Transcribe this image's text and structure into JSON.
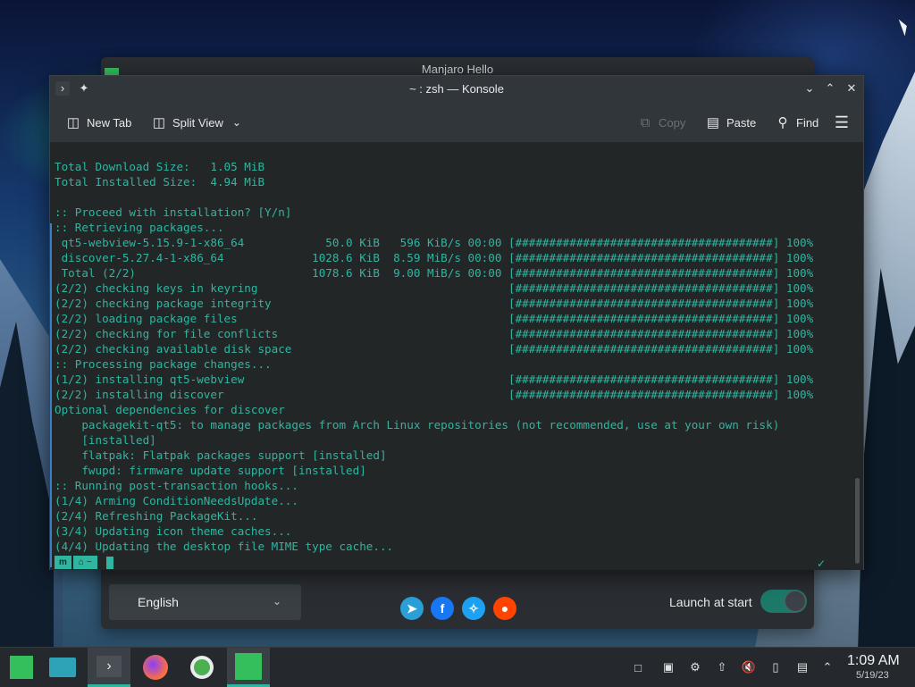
{
  "hello_window": {
    "title": "Manjaro Hello",
    "language": "English",
    "launch_label": "Launch at start",
    "launch_enabled": true
  },
  "konsole": {
    "title": "~ : zsh — Konsole",
    "toolbar": {
      "new_tab": "New Tab",
      "split_view": "Split View",
      "copy": "Copy",
      "paste": "Paste",
      "find": "Find"
    },
    "lines": [
      "Total Download Size:   1.05 MiB",
      "Total Installed Size:  4.94 MiB",
      "",
      ":: Proceed with installation? [Y/n]",
      ":: Retrieving packages...",
      " qt5-webview-5.15.9-1-x86_64            50.0 KiB   596 KiB/s 00:00 [######################################] 100%",
      " discover-5.27.4-1-x86_64             1028.6 KiB  8.59 MiB/s 00:00 [######################################] 100%",
      " Total (2/2)                          1078.6 KiB  9.00 MiB/s 00:00 [######################################] 100%",
      "(2/2) checking keys in keyring                                     [######################################] 100%",
      "(2/2) checking package integrity                                   [######################################] 100%",
      "(2/2) loading package files                                        [######################################] 100%",
      "(2/2) checking for file conflicts                                  [######################################] 100%",
      "(2/2) checking available disk space                                [######################################] 100%",
      ":: Processing package changes...",
      "(1/2) installing qt5-webview                                       [######################################] 100%",
      "(2/2) installing discover                                          [######################################] 100%",
      "Optional dependencies for discover",
      "    packagekit-qt5: to manage packages from Arch Linux repositories (not recommended, use at your own risk)",
      "    [installed]",
      "    flatpak: Flatpak packages support [installed]",
      "    fwupd: firmware update support [installed]",
      ":: Running post-transaction hooks...",
      "(1/4) Arming ConditionNeedsUpdate...",
      "(2/4) Refreshing PackageKit...",
      "(3/4) Updating icon theme caches...",
      "(4/4) Updating the desktop file MIME type cache..."
    ],
    "prompt_dir": "~",
    "prompt_check": "✓"
  },
  "taskbar": {
    "time": "1:09 AM",
    "date": "5/19/23"
  },
  "colors": {
    "terminal_text": "#2fb5a0",
    "accent": "#2fb5a0",
    "toggle_on": "#1d7a6a"
  }
}
